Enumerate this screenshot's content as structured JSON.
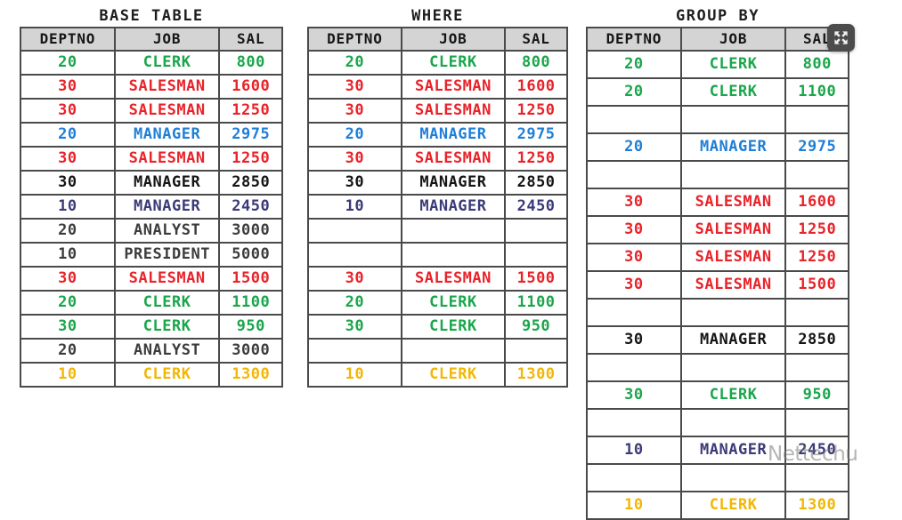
{
  "page": {
    "background": "#ffffff",
    "watermark": "Nettechu"
  },
  "colors": {
    "green": "#1aa64b",
    "red": "#e8232a",
    "blue": "#1f7fd6",
    "black": "#151515",
    "navy": "#3b3b78",
    "gray": "#3c3c3c",
    "yellow": "#f2b705",
    "header_bg": "#d4d4d4",
    "border": "#4a4a4a"
  },
  "columns": [
    "DEPTNO",
    "JOB",
    "SAL"
  ],
  "panels": [
    {
      "id": "base-table",
      "title": "BASE TABLE",
      "rows": [
        {
          "deptno": "20",
          "job": "CLERK",
          "sal": "800",
          "color": "green"
        },
        {
          "deptno": "30",
          "job": "SALESMAN",
          "sal": "1600",
          "color": "red"
        },
        {
          "deptno": "30",
          "job": "SALESMAN",
          "sal": "1250",
          "color": "red"
        },
        {
          "deptno": "20",
          "job": "MANAGER",
          "sal": "2975",
          "color": "blue"
        },
        {
          "deptno": "30",
          "job": "SALESMAN",
          "sal": "1250",
          "color": "red"
        },
        {
          "deptno": "30",
          "job": "MANAGER",
          "sal": "2850",
          "color": "black"
        },
        {
          "deptno": "10",
          "job": "MANAGER",
          "sal": "2450",
          "color": "navy"
        },
        {
          "deptno": "20",
          "job": "ANALYST",
          "sal": "3000",
          "color": "gray"
        },
        {
          "deptno": "10",
          "job": "PRESIDENT",
          "sal": "5000",
          "color": "gray"
        },
        {
          "deptno": "30",
          "job": "SALESMAN",
          "sal": "1500",
          "color": "red"
        },
        {
          "deptno": "20",
          "job": "CLERK",
          "sal": "1100",
          "color": "green"
        },
        {
          "deptno": "30",
          "job": "CLERK",
          "sal": "950",
          "color": "green"
        },
        {
          "deptno": "20",
          "job": "ANALYST",
          "sal": "3000",
          "color": "gray"
        },
        {
          "deptno": "10",
          "job": "CLERK",
          "sal": "1300",
          "color": "yellow"
        }
      ]
    },
    {
      "id": "where",
      "title": "WHERE",
      "rows": [
        {
          "deptno": "20",
          "job": "CLERK",
          "sal": "800",
          "color": "green"
        },
        {
          "deptno": "30",
          "job": "SALESMAN",
          "sal": "1600",
          "color": "red"
        },
        {
          "deptno": "30",
          "job": "SALESMAN",
          "sal": "1250",
          "color": "red"
        },
        {
          "deptno": "20",
          "job": "MANAGER",
          "sal": "2975",
          "color": "blue"
        },
        {
          "deptno": "30",
          "job": "SALESMAN",
          "sal": "1250",
          "color": "red"
        },
        {
          "deptno": "30",
          "job": "MANAGER",
          "sal": "2850",
          "color": "black"
        },
        {
          "deptno": "10",
          "job": "MANAGER",
          "sal": "2450",
          "color": "navy"
        },
        {
          "deptno": "",
          "job": "",
          "sal": "",
          "color": "empty"
        },
        {
          "deptno": "",
          "job": "",
          "sal": "",
          "color": "empty"
        },
        {
          "deptno": "30",
          "job": "SALESMAN",
          "sal": "1500",
          "color": "red"
        },
        {
          "deptno": "20",
          "job": "CLERK",
          "sal": "1100",
          "color": "green"
        },
        {
          "deptno": "30",
          "job": "CLERK",
          "sal": "950",
          "color": "green"
        },
        {
          "deptno": "",
          "job": "",
          "sal": "",
          "color": "empty"
        },
        {
          "deptno": "10",
          "job": "CLERK",
          "sal": "1300",
          "color": "yellow"
        }
      ]
    },
    {
      "id": "group-by",
      "title": "GROUP BY",
      "rows": [
        {
          "deptno": "20",
          "job": "CLERK",
          "sal": "800",
          "color": "green"
        },
        {
          "deptno": "20",
          "job": "CLERK",
          "sal": "1100",
          "color": "green"
        },
        {
          "deptno": "",
          "job": "",
          "sal": "",
          "color": "empty"
        },
        {
          "deptno": "20",
          "job": "MANAGER",
          "sal": "2975",
          "color": "blue"
        },
        {
          "deptno": "",
          "job": "",
          "sal": "",
          "color": "empty"
        },
        {
          "deptno": "30",
          "job": "SALESMAN",
          "sal": "1600",
          "color": "red"
        },
        {
          "deptno": "30",
          "job": "SALESMAN",
          "sal": "1250",
          "color": "red"
        },
        {
          "deptno": "30",
          "job": "SALESMAN",
          "sal": "1250",
          "color": "red"
        },
        {
          "deptno": "30",
          "job": "SALESMAN",
          "sal": "1500",
          "color": "red"
        },
        {
          "deptno": "",
          "job": "",
          "sal": "",
          "color": "empty"
        },
        {
          "deptno": "30",
          "job": "MANAGER",
          "sal": "2850",
          "color": "black"
        },
        {
          "deptno": "",
          "job": "",
          "sal": "",
          "color": "empty"
        },
        {
          "deptno": "30",
          "job": "CLERK",
          "sal": "950",
          "color": "green"
        },
        {
          "deptno": "",
          "job": "",
          "sal": "",
          "color": "empty"
        },
        {
          "deptno": "10",
          "job": "MANAGER",
          "sal": "2450",
          "color": "navy"
        },
        {
          "deptno": "",
          "job": "",
          "sal": "",
          "color": "empty"
        },
        {
          "deptno": "10",
          "job": "CLERK",
          "sal": "1300",
          "color": "yellow"
        }
      ]
    }
  ],
  "fullscreen_button": {
    "icon": "fullscreen-expand-icon",
    "label": ""
  }
}
